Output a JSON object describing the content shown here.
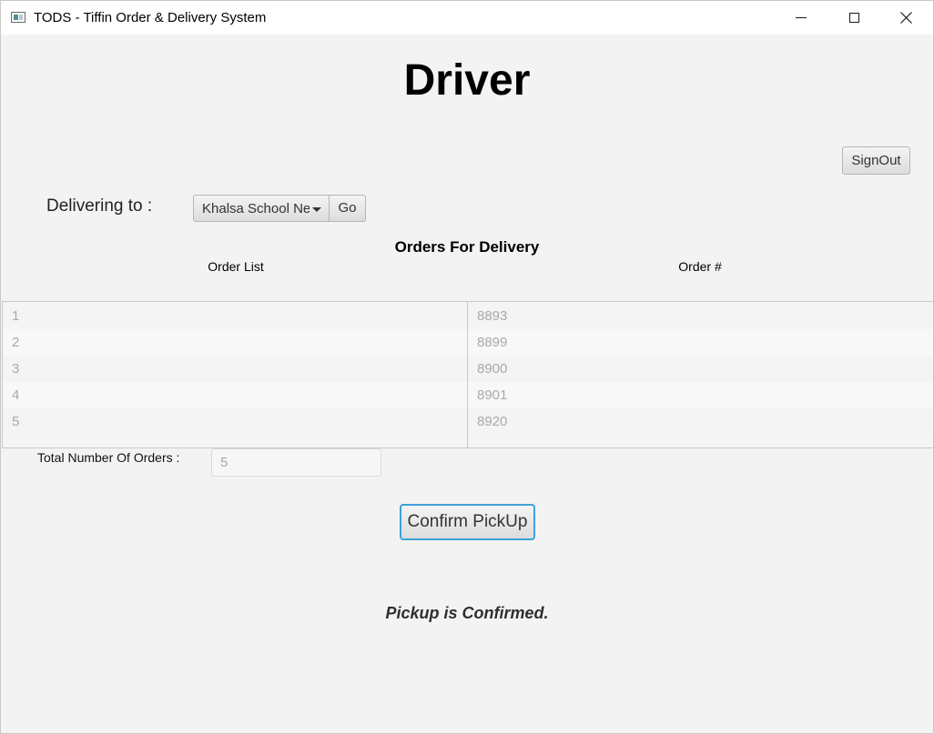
{
  "window": {
    "title": "TODS - Tiffin Order & Delivery System",
    "icons": {
      "app": "app-window-icon",
      "minimize": "minimize-icon",
      "maximize": "maximize-icon",
      "close": "close-icon"
    }
  },
  "header": {
    "title": "Driver",
    "signout_label": "SignOut"
  },
  "delivery": {
    "label": "Delivering to :",
    "selected_location": "Khalsa School Ne...",
    "go_label": "Go"
  },
  "orders": {
    "section_title": "Orders For Delivery",
    "columns": [
      "Order List",
      "Order #"
    ],
    "order_list": [
      "1",
      "2",
      "3",
      "4",
      "5"
    ],
    "order_numbers": [
      "8893",
      "8899",
      "8900",
      "8901",
      "8920"
    ]
  },
  "summary": {
    "total_label": "Total Number Of Orders :",
    "total_value": "5"
  },
  "actions": {
    "confirm_label": "Confirm PickUp",
    "status_message": "Pickup is Confirmed."
  },
  "colors": {
    "background": "#f3f3f3",
    "focus_border": "#3ea2d8",
    "muted_text": "#a9a9a9"
  }
}
